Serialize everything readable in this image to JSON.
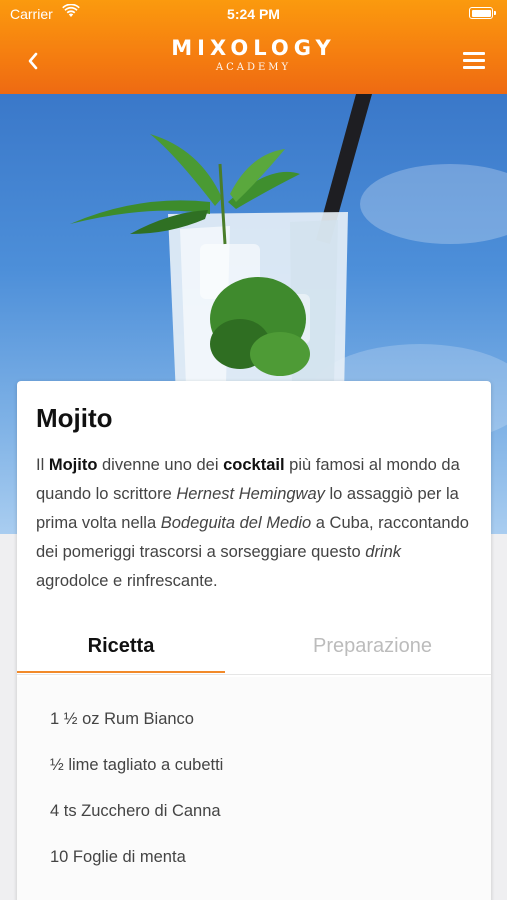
{
  "status_bar": {
    "carrier": "Carrier",
    "time": "5:24 PM"
  },
  "header": {
    "brand": "MIXOLOGY",
    "brand_sub": "ACADEMY",
    "back_icon": "chevron-left-icon",
    "menu_icon": "hamburger-menu-icon",
    "colors": {
      "gradient_top": "#fb9a0e",
      "gradient_bottom": "#ee6a12"
    }
  },
  "cocktail": {
    "name": "Mojito",
    "description": {
      "p1": "Il ",
      "b1": "Mojito",
      "p2": " divenne uno dei ",
      "b2": "cocktail",
      "p3": " più famosi al mondo da quando lo scrittore ",
      "i1": "Hernest Hemingway",
      "p4": " lo assaggiò per la prima volta nella ",
      "i2": "Bodeguita del Medio",
      "p5": " a Cuba, raccontando dei pomeriggi trascorsi a sorseggiare questo ",
      "i3": "drink",
      "p6": " agrodolce e rinfrescante."
    }
  },
  "tabs": {
    "recipe": "Ricetta",
    "preparation": "Preparazione",
    "active": "Ricetta",
    "accent_color": "#f28a2a"
  },
  "ingredients": [
    "1 ½ oz Rum Bianco",
    "½ lime tagliato a cubetti",
    "4 ts Zucchero di Canna",
    "10 Foglie di menta"
  ]
}
